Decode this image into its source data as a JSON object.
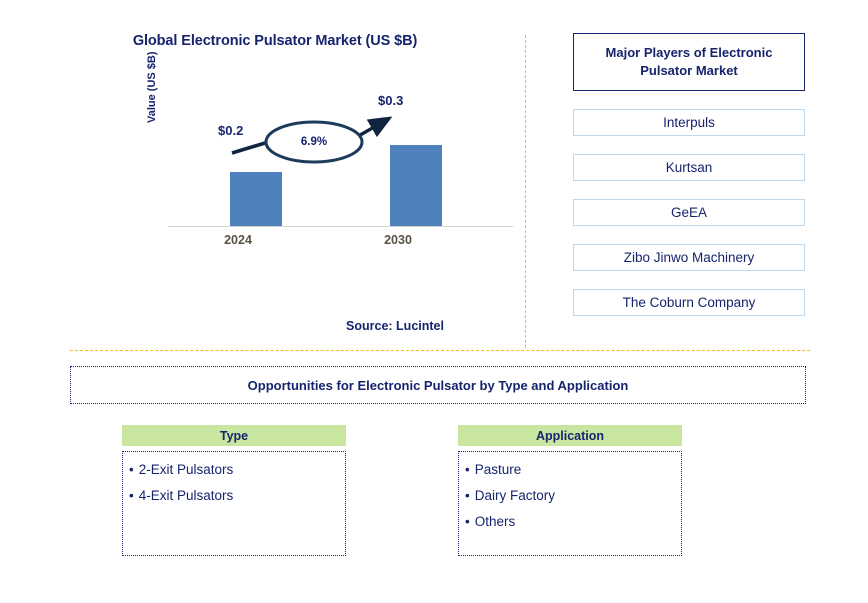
{
  "chart": {
    "title": "Global Electronic Pulsator Market (US $B)",
    "y_axis_label": "Value (US $B)",
    "cagr_label": "6.9%",
    "source": "Source: Lucintel",
    "bar_color": "#4f81bd",
    "label_2024": "$0.2",
    "label_2030": "$0.3",
    "tick_2024": "2024",
    "tick_2030": "2030"
  },
  "chart_data": {
    "type": "bar",
    "title": "Global Electronic Pulsator Market (US $B)",
    "categories": [
      "2024",
      "2030"
    ],
    "values": [
      0.2,
      0.3
    ],
    "value_labels": [
      "$0.2",
      "$0.3"
    ],
    "xlabel": "",
    "ylabel": "Value (US $B)",
    "ylim": [
      0,
      0.45
    ],
    "grid": false,
    "legend": "none",
    "series": [
      {
        "name": "Value (US $B)",
        "values": [
          0.2,
          0.3
        ]
      }
    ],
    "annotations": [
      {
        "text": "6.9%",
        "type": "cagr-ellipse",
        "from": "2024",
        "to": "2030"
      }
    ],
    "source": "Source: Lucintel",
    "bar_color": "#4f81bd"
  },
  "players": {
    "header": "Major Players of Electronic Pulsator Market",
    "items": [
      "Interpuls",
      "Kurtsan",
      "GeEA",
      "Zibo Jinwo Machinery",
      "The Coburn Company"
    ]
  },
  "opportunities": {
    "banner": "Opportunities for Electronic Pulsator by Type and Application",
    "columns": [
      {
        "header": "Type",
        "items": [
          "2-Exit Pulsators",
          "4-Exit Pulsators"
        ]
      },
      {
        "header": "Application",
        "items": [
          "Pasture",
          "Dairy Factory",
          "Others"
        ]
      }
    ]
  },
  "colors": {
    "navy": "#16246e",
    "bar_blue": "#4f81bd",
    "divider_orange": "#fdb913",
    "header_green": "#c8e6a0",
    "player_border": "#bdd7ee"
  },
  "bullet_glyph": "•"
}
